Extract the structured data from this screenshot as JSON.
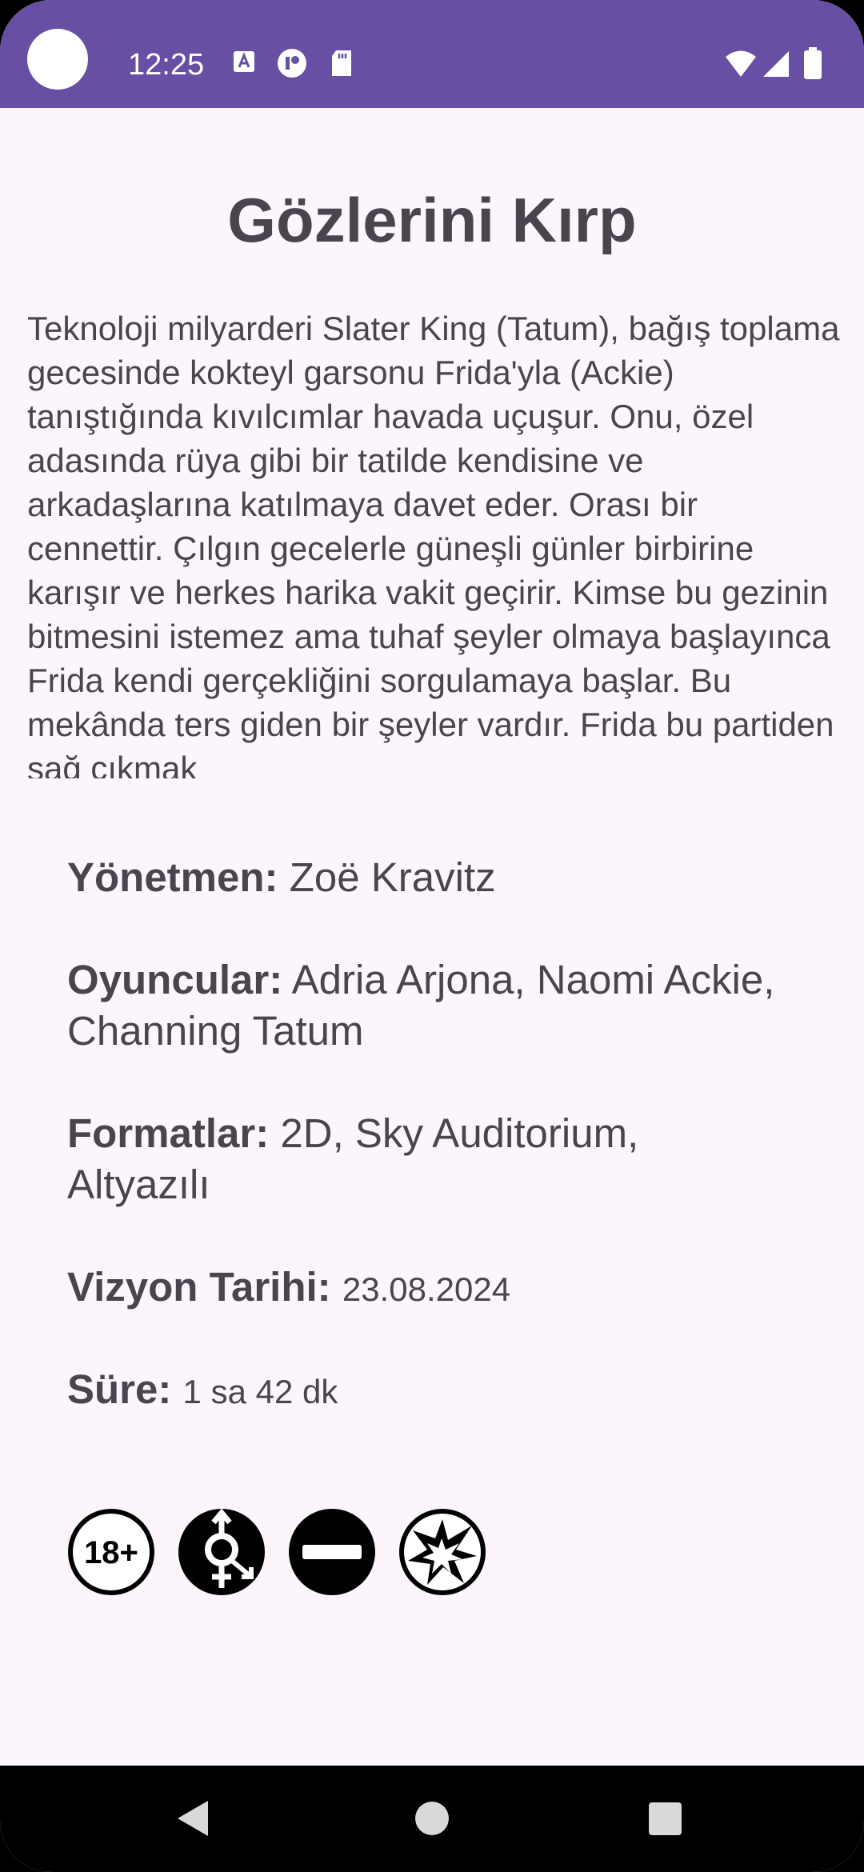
{
  "status_bar": {
    "time": "12:25",
    "icons_left": [
      "text-notification-icon",
      "app-notification-icon",
      "sd-card-icon"
    ],
    "icons_right": [
      "wifi-icon",
      "cellular-signal-icon",
      "battery-icon"
    ],
    "color": "#6750a4"
  },
  "movie": {
    "title": "Gözlerini Kırp",
    "synopsis": "Teknoloji milyarderi Slater King (Tatum), bağış toplama gecesinde kokteyl garsonu Frida'yla (Ackie) tanıştığında kıvılcımlar havada uçuşur. Onu, özel adasında rüya gibi bir tatilde kendisine ve arkadaşlarına katılmaya davet eder. Orası bir cennettir. Çılgın gecelerle güneşli günler birbirine karışır ve herkes harika vakit geçirir. Kimse bu gezinin bitmesini istemez ama tuhaf şeyler olmaya başlayınca Frida kendi gerçekliğini sorgulamaya başlar. Bu mekânda ters giden bir şeyler vardır. Frida bu partiden sağ çıkmak",
    "director_label": "Yönetmen:",
    "director": "Zoë Kravitz",
    "cast_label": "Oyuncular:",
    "cast": "Adria Arjona, Naomi Ackie, Channing Tatum",
    "formats_label": "Formatlar:",
    "formats": "2D, Sky Auditorium, Altyazılı",
    "release_label": "Vizyon Tarihi:",
    "release_date": "23.08.2024",
    "duration_label": "Süre:",
    "duration": "1 sa 42 dk",
    "age_rating": "18+",
    "rating_icons": [
      "age-18-plus-icon",
      "sexuality-icon",
      "negative-example-icon",
      "violence-icon"
    ]
  },
  "nav": {
    "buttons": [
      "back-button",
      "home-button",
      "recents-button"
    ]
  }
}
